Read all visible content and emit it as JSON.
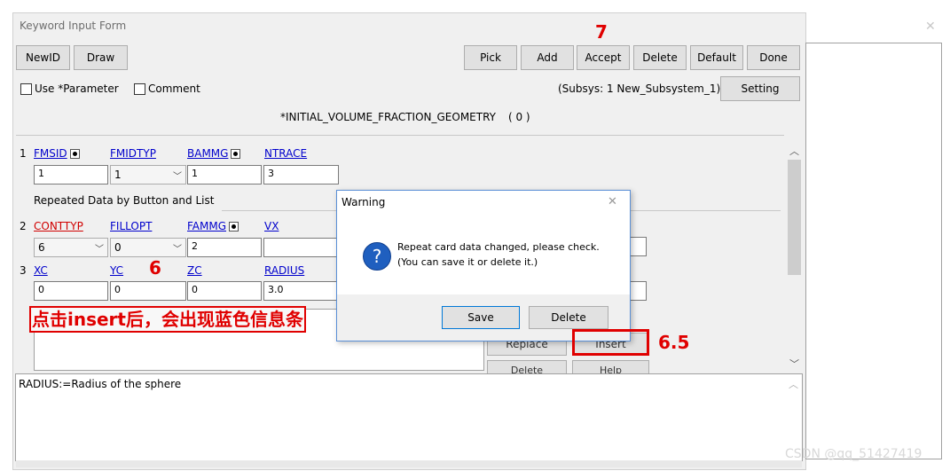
{
  "window": {
    "title": "Keyword Input Form"
  },
  "toolbar": {
    "newid": "NewID",
    "draw": "Draw",
    "pick": "Pick",
    "add": "Add",
    "accept": "Accept",
    "delete": "Delete",
    "default": "Default",
    "done": "Done"
  },
  "options": {
    "use_parameter": "Use *Parameter",
    "comment": "Comment",
    "subsys": "(Subsys: 1 New_Subsystem_1)",
    "setting": "Setting"
  },
  "keyword_title": "*INITIAL_VOLUME_FRACTION_GEOMETRY",
  "keyword_count": "( 0 )",
  "card1": {
    "num": "1",
    "fields": [
      {
        "label": "FMSID",
        "value": "1"
      },
      {
        "label": "FMIDTYP",
        "value": "1"
      },
      {
        "label": "BAMMG",
        "value": "1"
      },
      {
        "label": "NTRACE",
        "value": "3"
      }
    ]
  },
  "repeated_label": "Repeated Data by Button and List",
  "card2": {
    "num": "2",
    "fields": [
      {
        "label": "CONTTYP",
        "value": "6"
      },
      {
        "label": "FILLOPT",
        "value": "0"
      },
      {
        "label": "FAMMG",
        "value": "2"
      },
      {
        "label": "VX",
        "value": ""
      }
    ]
  },
  "card3": {
    "num": "3",
    "fields": [
      {
        "label": "XC",
        "value": "0"
      },
      {
        "label": "YC",
        "value": "0"
      },
      {
        "label": "ZC",
        "value": "0"
      },
      {
        "label": "RADIUS",
        "value": "3.0"
      }
    ]
  },
  "list_buttons": {
    "replace": "Replace",
    "insert": "Insert",
    "delete": "Delete",
    "help": "Help"
  },
  "help_text": "RADIUS:=Radius of the sphere",
  "dialog": {
    "title": "Warning",
    "message_line1": "Repeat card data changed, please check.",
    "message_line2": "(You can save it or delete it.)",
    "save": "Save",
    "delete": "Delete",
    "icon": "question-icon"
  },
  "annotations": {
    "seven": "7",
    "six": "6",
    "six_five": "6.5",
    "chinese_note": "点击insert后，会出现蓝色信息条"
  },
  "watermark": "CSDN @qq_51427419",
  "colors": {
    "annotation_red": "#e00000",
    "link_blue": "#0000cc",
    "required_red": "#d00000",
    "dialog_border": "#5a8fd6"
  }
}
